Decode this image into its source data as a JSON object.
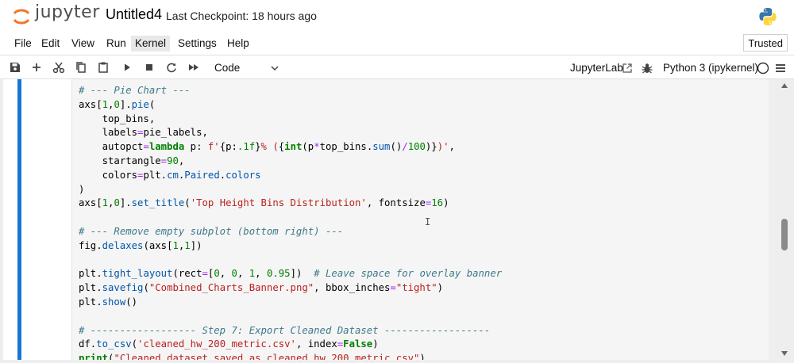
{
  "header": {
    "logo_text": "jupyter",
    "notebook_title": "Untitled4",
    "checkpoint": "Last Checkpoint: 18 hours ago"
  },
  "menu": {
    "items": [
      "File",
      "Edit",
      "View",
      "Run",
      "Kernel",
      "Settings",
      "Help"
    ],
    "active": "Kernel",
    "trusted": "Trusted"
  },
  "toolbar": {
    "cell_type": "Code",
    "jupyterlab_link": "JupyterLab",
    "kernel_name": "Python 3 (ipykernel)",
    "icons": [
      "save-icon",
      "add-cell-icon",
      "cut-icon",
      "copy-icon",
      "paste-icon",
      "run-icon",
      "stop-icon",
      "restart-icon",
      "run-all-icon"
    ]
  },
  "code_lines": [
    "# --- Pie Chart ---",
    "axs[1,0].pie(",
    "    top_bins,",
    "    labels=pie_labels,",
    "    autopct=lambda p: f'{p:.1f}% ({int(p*top_bins.sum()/100)})',",
    "    startangle=90,",
    "    colors=plt.cm.Paired.colors",
    ")",
    "axs[1,0].set_title('Top Height Bins Distribution', fontsize=16)",
    "",
    "# --- Remove empty subplot (bottom right) ---",
    "fig.delaxes(axs[1,1])",
    "",
    "plt.tight_layout(rect=[0, 0, 1, 0.95])  # Leave space for overlay banner",
    "plt.savefig(\"Combined_Charts_Banner.png\", bbox_inches=\"tight\")",
    "plt.show()",
    "",
    "# ------------------ Step 7: Export Cleaned Dataset ------------------",
    "df.to_csv('cleaned_hw_200_metric.csv', index=False)",
    "print(\"Cleaned dataset saved as cleaned_hw_200_metric.csv\")"
  ],
  "colors": {
    "accent": "#1976d2",
    "comment": "#3c7a8a",
    "string": "#ba2121",
    "number": "#008000",
    "function": "#0055aa"
  }
}
